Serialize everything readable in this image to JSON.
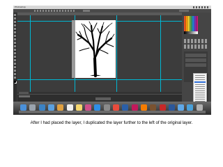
{
  "caption": "After I had placed the layer, I duplicated the layer further to the left of the original layer.",
  "app": {
    "name": "Photoshop",
    "theme_colors": {
      "chrome": "#3a3a3a",
      "guide": "#00b8d4",
      "menu_highlight": "#2f6fd8"
    }
  },
  "menubar": {
    "app_label": "Photoshop"
  },
  "document": {
    "content": "bare tree silhouette on white background",
    "guides": "cyan"
  },
  "dock_icons": [
    "finder-icon",
    "launchpad-icon",
    "safari-icon",
    "mail-icon",
    "photos-icon",
    "calendar-icon",
    "notes-icon",
    "itunes-icon",
    "app-store-icon",
    "preferences-icon",
    "chrome-icon",
    "photoshop-icon",
    "indesign-icon",
    "illustrator-icon",
    "bridge-icon",
    "acrobat-icon",
    "word-icon",
    "folder-icon",
    "downloads-icon",
    "trash-icon"
  ]
}
